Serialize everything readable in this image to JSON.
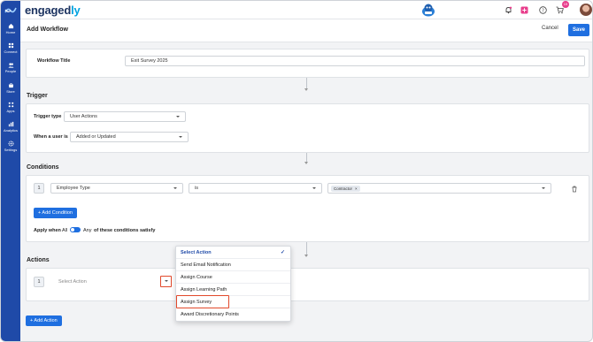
{
  "app": {
    "brand_main": "engaged",
    "brand_suffix": "ly",
    "notification_count": "19"
  },
  "sidebar": {
    "items": [
      {
        "label": "Home",
        "icon": "home-icon"
      },
      {
        "label": "Connect",
        "icon": "connect-icon"
      },
      {
        "label": "People",
        "icon": "people-icon"
      },
      {
        "label": "Store",
        "icon": "store-icon"
      },
      {
        "label": "Apps",
        "icon": "apps-icon"
      },
      {
        "label": "Analytics",
        "icon": "analytics-icon"
      },
      {
        "label": "Settings",
        "icon": "settings-icon"
      }
    ]
  },
  "header": {
    "title": "Add Workflow",
    "cancel_label": "Cancel",
    "save_label": "Save"
  },
  "workflow": {
    "title_label": "Workflow Title",
    "title_value": "Exit Survey 2025"
  },
  "trigger": {
    "section_title": "Trigger",
    "type_label": "Trigger type",
    "type_value": "User Actions",
    "when_label": "When a user is",
    "when_value": "Added or Updated"
  },
  "conditions": {
    "section_title": "Conditions",
    "row_index": "1",
    "field_value": "Employee Type",
    "operator_value": "is",
    "chip_value": "Contractor",
    "chip_close": "×",
    "add_button": "+ Add Condition",
    "apply_prefix": "Apply when",
    "apply_all": "All",
    "apply_any": "Any",
    "apply_suffix": "of these conditions satisfy"
  },
  "actions": {
    "section_title": "Actions",
    "row_index": "1",
    "select_placeholder": "Select Action",
    "add_button": "+ Add Action",
    "dropdown": {
      "options": [
        "Select Action",
        "Send Email Notification",
        "Assign Course",
        "Assign Learning Path",
        "Assign Survey",
        "Award Discretionary Points"
      ],
      "selected": "Select Action",
      "highlighted": "Assign Survey",
      "check": "✓"
    }
  },
  "colors": {
    "accent": "#1f6fe0",
    "sidebar": "#1f4aa8",
    "highlight": "#e2492b"
  }
}
